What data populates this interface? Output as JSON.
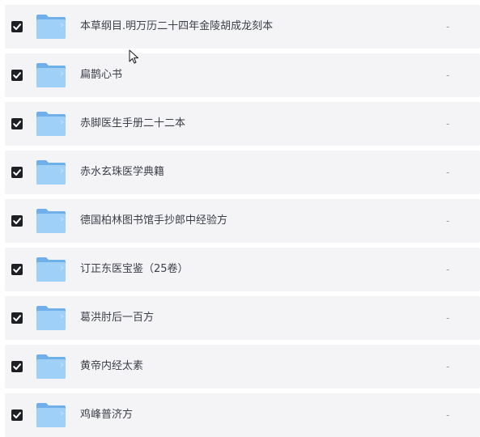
{
  "files": [
    {
      "name": "本草纲目.明万历二十四年金陵胡成龙刻本",
      "size": "-",
      "checked": true
    },
    {
      "name": "扁鹊心书",
      "size": "-",
      "checked": true
    },
    {
      "name": "赤脚医生手册二十二本",
      "size": "-",
      "checked": true
    },
    {
      "name": "赤水玄珠医学典籍",
      "size": "-",
      "checked": true
    },
    {
      "name": "德国柏林图书馆手抄郎中经验方",
      "size": "-",
      "checked": true
    },
    {
      "name": "订正东医宝鉴（25卷）",
      "size": "-",
      "checked": true
    },
    {
      "name": "葛洪肘后一百方",
      "size": "-",
      "checked": true
    },
    {
      "name": "黄帝内经太素",
      "size": "-",
      "checked": true
    },
    {
      "name": "鸡峰普济方",
      "size": "-",
      "checked": true
    }
  ],
  "colors": {
    "row_background": "#f4f4f6",
    "checkbox": "#1f2026",
    "folder_front": "#9fd0f7",
    "folder_back": "#6fb0ea",
    "text": "#3b3f49",
    "size_text": "#9a9ea8"
  },
  "icons": {
    "checkbox": "checkmark-icon",
    "folder": "folder-icon",
    "cursor": "mouse-pointer-icon"
  }
}
